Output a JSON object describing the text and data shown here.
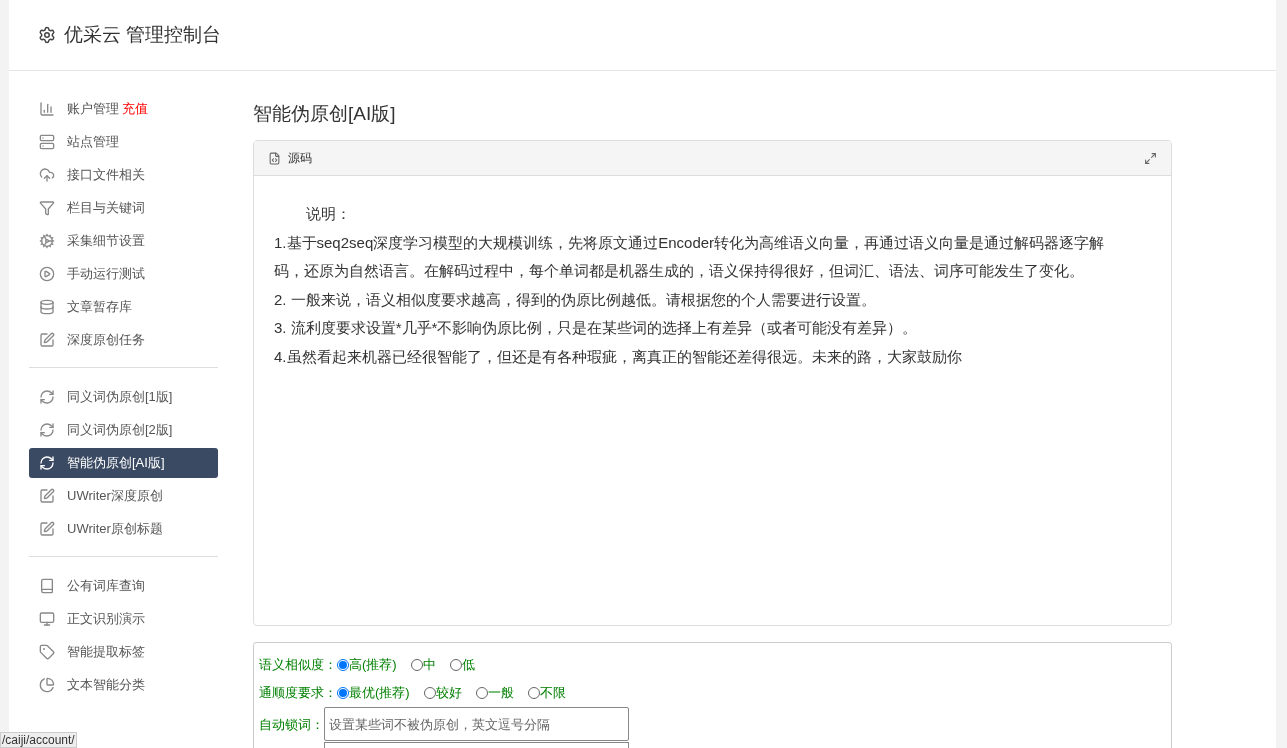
{
  "header": {
    "title": "优采云 管理控制台"
  },
  "sidebar": {
    "groups": [
      {
        "items": [
          {
            "label": "账户管理",
            "badge": "充值",
            "selected": false
          },
          {
            "label": "站点管理",
            "selected": false
          },
          {
            "label": "接口文件相关",
            "selected": false
          },
          {
            "label": "栏目与关键词",
            "selected": false
          },
          {
            "label": "采集细节设置",
            "selected": false
          },
          {
            "label": "手动运行测试",
            "selected": false
          },
          {
            "label": "文章暂存库",
            "selected": false
          },
          {
            "label": "深度原创任务",
            "selected": false
          }
        ]
      },
      {
        "items": [
          {
            "label": "同义词伪原创[1版]",
            "selected": false
          },
          {
            "label": "同义词伪原创[2版]",
            "selected": false
          },
          {
            "label": "智能伪原创[AI版]",
            "selected": true
          },
          {
            "label": "UWriter深度原创",
            "selected": false
          },
          {
            "label": "UWriter原创标题",
            "selected": false
          }
        ]
      },
      {
        "items": [
          {
            "label": "公有词库查询",
            "selected": false
          },
          {
            "label": "正文识别演示",
            "selected": false
          },
          {
            "label": "智能提取标签",
            "selected": false
          },
          {
            "label": "文本智能分类",
            "selected": false
          }
        ]
      }
    ]
  },
  "page_title": "智能伪原创[AI版]",
  "panel": {
    "tab": "源码",
    "heading": "说明：",
    "paragraphs": [
      "1.基于seq2seq深度学习模型的大规模训练，先将原文通过Encoder转化为高维语义向量，再通过语义向量是通过解码器逐字解码，还原为自然语言。在解码过程中，每个单词都是机器生成的，语义保持得很好，但词汇、语法、词序可能发生了变化。",
      "2. 一般来说，语义相似度要求越高，得到的伪原比例越低。请根据您的个人需要进行设置。",
      "3. 流利度要求设置*几乎*不影响伪原比例，只是在某些词的选择上有差异（或者可能没有差异）。",
      "4.虽然看起来机器已经很智能了，但还是有各种瑕疵，离真正的智能还差得很远。未来的路，大家鼓励你"
    ]
  },
  "form": {
    "radio_groups": [
      {
        "label": "语义相似度：",
        "options": [
          {
            "label": "高(推荐)",
            "selected": true
          },
          {
            "label": "中",
            "selected": false
          },
          {
            "label": "低",
            "selected": false
          }
        ]
      },
      {
        "label": "通顺度要求：",
        "options": [
          {
            "label": "最优(推荐)",
            "selected": true
          },
          {
            "label": "较好",
            "selected": false
          },
          {
            "label": "一般",
            "selected": false
          },
          {
            "label": "不限",
            "selected": false
          }
        ]
      }
    ],
    "lock_words": {
      "label": "自动锁词：",
      "placeholder": "设置某些词不被伪原创，英文逗号分隔"
    }
  },
  "status_url": "/caiji/account/"
}
